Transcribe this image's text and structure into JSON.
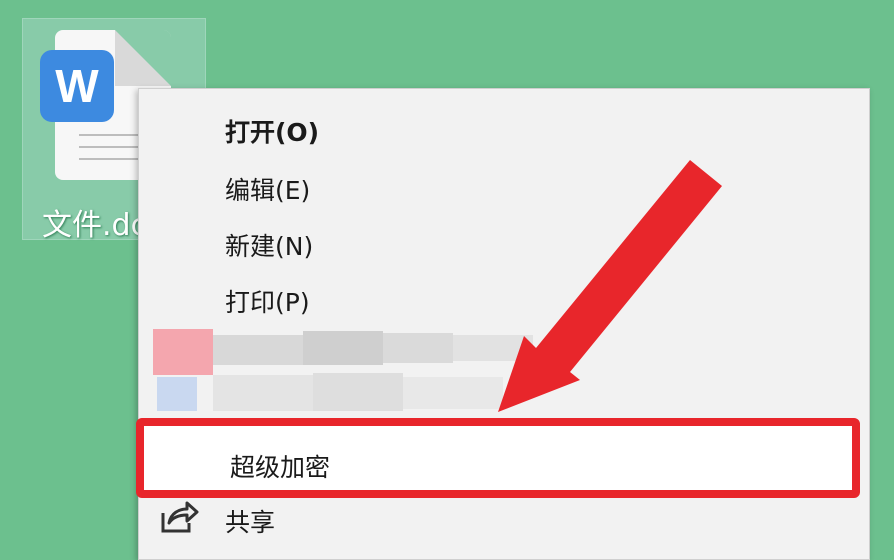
{
  "desktop": {
    "file_name": "文件.dc",
    "file_badge": "W"
  },
  "menu": {
    "open": "打开(O)",
    "edit": "编辑(E)",
    "new": "新建(N)",
    "print": "打印(P)",
    "encrypt": "超级加密",
    "share": "共享"
  },
  "icons": {
    "file": "word-document-icon",
    "share": "share-icon",
    "annotation": "red-arrow"
  },
  "colors": {
    "desktop_bg": "#6cc08e",
    "word_blue": "#3d8ae0",
    "highlight_red": "#e8262b",
    "menu_bg": "#f2f2f2"
  }
}
